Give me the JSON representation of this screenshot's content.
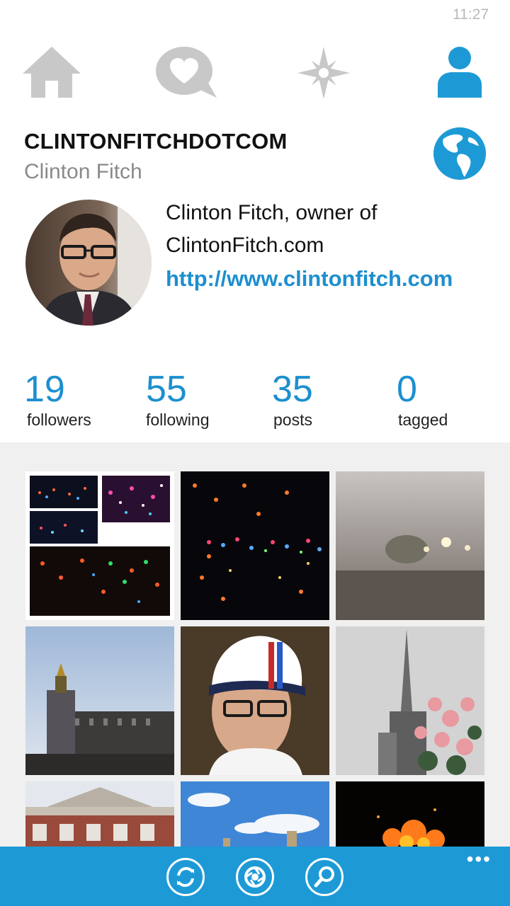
{
  "status_bar": {
    "time": "11:27"
  },
  "nav": {
    "icons": [
      "home-icon",
      "activity-heart-icon",
      "explore-compass-icon",
      "profile-person-icon"
    ],
    "active": "profile-person-icon",
    "inactive_color": "#c8c8c8",
    "active_color": "#1d9ad6"
  },
  "profile": {
    "username": "CLINTONFITCHDOTCOM",
    "full_name": "Clinton Fitch",
    "bio_line_1": "Clinton Fitch, owner of",
    "bio_line_2": "ClintonFitch.com",
    "website": "http://www.clintonfitch.com"
  },
  "stats": {
    "followers": {
      "value": "19",
      "label": "followers"
    },
    "following": {
      "value": "55",
      "label": "following"
    },
    "posts": {
      "value": "35",
      "label": "posts"
    },
    "tagged": {
      "value": "0",
      "label": "tagged"
    }
  },
  "grid": {
    "photos": [
      "light-trees-collage",
      "christmas-lights-trees",
      "foggy-night-street",
      "victoria-memorial-palace",
      "selfie-williams-martini-cap",
      "cathedral-spire-roses",
      "museum-facade",
      "city-skyline-blue-sky",
      "bonfire-night"
    ]
  },
  "app_bar": {
    "buttons": [
      "refresh-icon",
      "camera-icon",
      "search-icon"
    ],
    "more": "•••",
    "color": "#1d9ad6"
  },
  "accent_color": "#1d8fcf"
}
